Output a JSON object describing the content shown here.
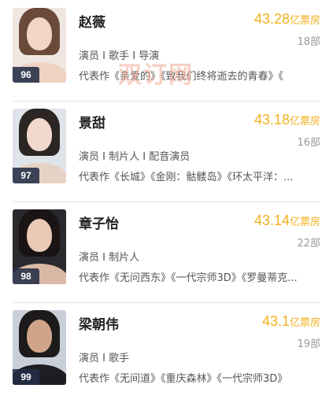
{
  "actors": [
    {
      "name": "赵薇",
      "box_office": "43.28",
      "box_office_unit": "亿票房",
      "film_count": "18部",
      "roles": "演员 I 歌手 I 导演",
      "works": "代表作《亲爱的》《致我们终将逝去的青春》《",
      "score": "96"
    },
    {
      "name": "景甜",
      "box_office": "43.18",
      "box_office_unit": "亿票房",
      "film_count": "16部",
      "roles": "演员 I 制片人 I 配音演员",
      "works": "代表作《长城》《金刚：骷髅岛》《环太平洋：...",
      "score": "97"
    },
    {
      "name": "章子怡",
      "box_office": "43.14",
      "box_office_unit": "亿票房",
      "film_count": "22部",
      "roles": "演员 I 制片人",
      "works": "代表作《无问西东》《一代宗师3D》《罗曼蒂克...",
      "score": "98"
    },
    {
      "name": "梁朝伟",
      "box_office": "43.1",
      "box_office_unit": "亿票房",
      "film_count": "19部",
      "roles": "演员 I 歌手",
      "works": "代表作《无间道》《重庆森林》《一代宗师3D》",
      "score": "99"
    }
  ],
  "watermark": "双订网",
  "colors": {
    "box_office": "#f2b01c",
    "badge_bg": "#232d46",
    "divider": "#e6e6e6"
  }
}
